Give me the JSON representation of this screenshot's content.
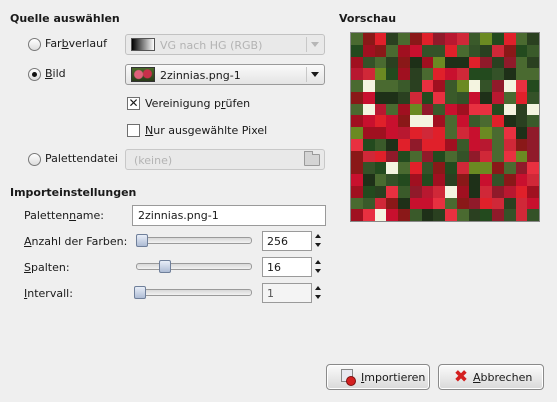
{
  "source": {
    "title": "Quelle auswählen",
    "gradient": {
      "label_pre": "Far",
      "label_mn": "b",
      "label_post": "verlauf",
      "value": "VG nach HG (RGB)"
    },
    "image": {
      "label_pre": "",
      "label_mn": "B",
      "label_post": "ild",
      "value": "2zinnias.png-1"
    },
    "merge_check": {
      "label_pre": "Vereinigung p",
      "label_mn": "r",
      "label_post": "üfen",
      "checked_mark": "✕"
    },
    "selected_only": {
      "label_pre": "",
      "label_mn": "N",
      "label_post": "ur ausgewählte Pixel"
    },
    "palette_file": {
      "label": "Palettendatei",
      "value": "(keine)"
    }
  },
  "import_settings": {
    "title": "Importeinstellungen",
    "palette_name": {
      "label_pre": "Paletten",
      "label_mn": "n",
      "label_post": "ame:",
      "value": "2zinnias.png-1"
    },
    "num_colors": {
      "label_pre": "",
      "label_mn": "A",
      "label_post": "nzahl der Farben:",
      "value": "256",
      "level": 0
    },
    "columns": {
      "label_pre": "",
      "label_mn": "S",
      "label_post": "palten:",
      "value": "16",
      "level": 0.2
    },
    "interval": {
      "label_pre": "",
      "label_mn": "I",
      "label_post": "ntervall:",
      "value": "1",
      "level": 0
    }
  },
  "preview": {
    "title": "Vorschau"
  },
  "buttons": {
    "import": {
      "label_pre": "",
      "label_mn": "I",
      "label_post": "mportieren"
    },
    "cancel": {
      "label_pre": "",
      "label_mn": "A",
      "label_post": "bbrechen"
    }
  },
  "icons": {
    "gradient_combo": "gradient-swatch-icon",
    "image_combo": "image-thumbnail-icon",
    "palette_file": "folder-icon",
    "import": "import-icon",
    "cancel": "cancel-icon"
  },
  "colors": {
    "background": "#efefef",
    "palette_swatches": [
      "#c8102e",
      "#e0202a",
      "#a01020",
      "#2a4020",
      "#3a5a2a",
      "#1e3018",
      "#d02838",
      "#4a6a30",
      "#8a1818",
      "#b81830",
      "#234a1e",
      "#e83040",
      "#6b8a22",
      "#f4f4e0",
      "#901a2a",
      "#345228"
    ]
  }
}
